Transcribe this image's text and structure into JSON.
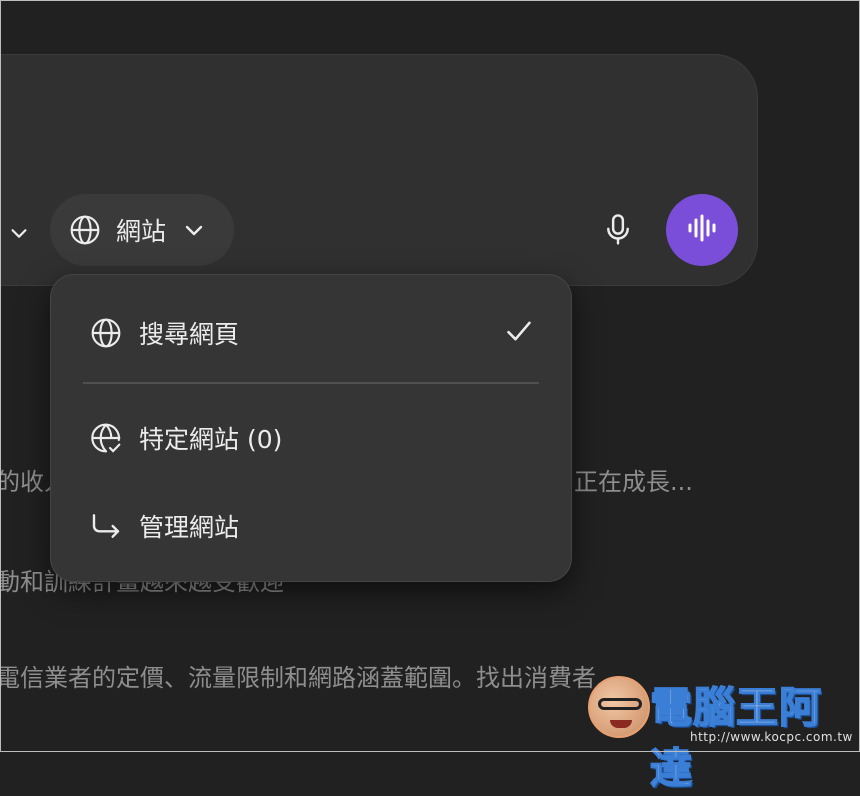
{
  "composer": {
    "source_pill": {
      "label": "網站",
      "icon": "globe-icon"
    },
    "left_control_icon": "chevron-down-icon",
    "mic_icon": "microphone-icon",
    "voice_icon": "voice-waveform-icon",
    "voice_button_color": "#7a4ed9"
  },
  "menu": {
    "items": [
      {
        "label": "搜尋網頁",
        "icon": "globe-icon",
        "selected": true
      },
      {
        "label": "特定網站 (0)",
        "icon": "globe-check-icon"
      },
      {
        "label": "管理網站",
        "icon": "arrow-corner-down-right-icon"
      }
    ]
  },
  "background_lines": [
    {
      "text": "的收入",
      "id": "bg-line-1-left"
    },
    {
      "text": "正在成長...",
      "id": "bg-line-1-right"
    },
    {
      "text": "動和訓練計畫越來越受歡迎",
      "id": "bg-line-2"
    },
    {
      "text": "電信業者的定價、流量限制和網路涵蓋範圍。找出消費者...",
      "id": "bg-line-3"
    }
  ],
  "watermark": {
    "brand": "電腦王阿達",
    "url": "http://www.kocpc.com.tw"
  }
}
